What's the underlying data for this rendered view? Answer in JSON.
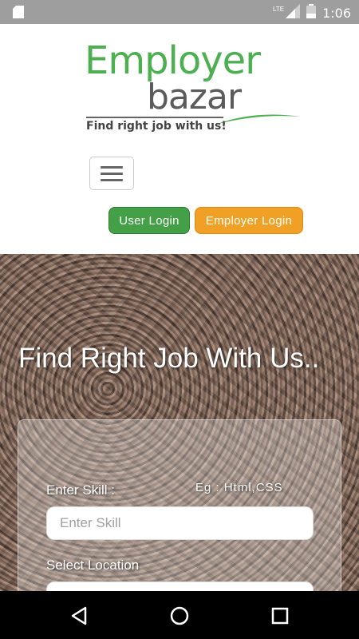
{
  "status_bar": {
    "time": "1:06",
    "network": "LTE",
    "icons": [
      "sd-card-icon",
      "signal-icon",
      "battery-icon"
    ]
  },
  "logo": {
    "word1": "Employer",
    "word2": "bazar",
    "tagline": "Find right job with us!",
    "colors": {
      "primary": "#4caf50",
      "secondary": "#5b5b5b"
    }
  },
  "header": {
    "menu_icon": "hamburger-menu-icon",
    "user_login_label": "User Login",
    "employer_login_label": "Employer Login",
    "colors": {
      "user_login": "#43a047",
      "employer_login": "#f0a024"
    }
  },
  "hero": {
    "title": "Find Right Job With Us..",
    "skill_label": "Enter Skill :",
    "skill_hint": "Eg : Html,CSS",
    "skill_placeholder": "Enter Skill",
    "location_label": "Select Location"
  },
  "nav_bar": {
    "icons": [
      "back-icon",
      "home-icon",
      "recents-icon"
    ]
  }
}
